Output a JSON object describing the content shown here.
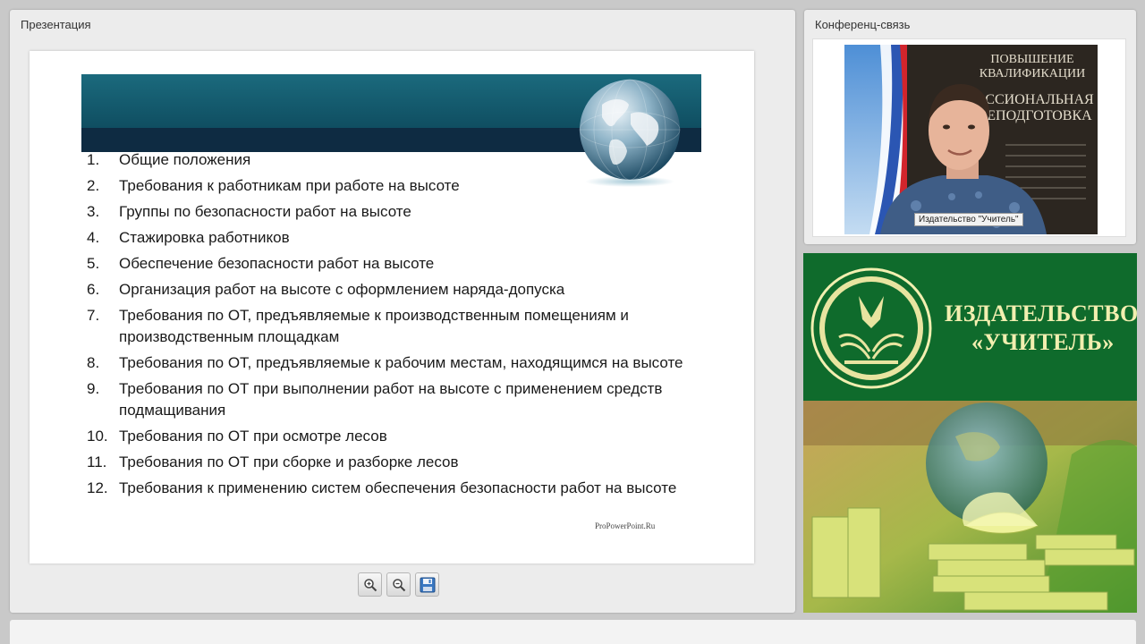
{
  "presentation_panel": {
    "title": "Презентация",
    "slide": {
      "items": [
        {
          "num": "1.",
          "text": "Общие положения"
        },
        {
          "num": "2.",
          "text": "Требования к работникам при работе на высоте"
        },
        {
          "num": "3.",
          "text": "Группы по безопасности работ на высоте"
        },
        {
          "num": "4.",
          "text": "Стажировка работников"
        },
        {
          "num": "5.",
          "text": "Обеспечение безопасности работ на высоте"
        },
        {
          "num": "6.",
          "text": "Организация работ на высоте с оформлением наряда-допуска"
        },
        {
          "num": "7.",
          "text": "Требования по ОТ, предъявляемые к производственным помещениям и производственным площадкам"
        },
        {
          "num": "8.",
          "text": "Требования по ОТ, предъявляемые к рабочим местам, находящимся на высоте"
        },
        {
          "num": "9.",
          "text": "Требования по ОТ при выполнении работ на высоте с применением средств подмащивания"
        },
        {
          "num": "10.",
          "text": "Требования по ОТ при осмотре лесов"
        },
        {
          "num": "11.",
          "text": "Требования по ОТ при сборке и разборке лесов"
        },
        {
          "num": "12.",
          "text": "Требования к применению систем обеспечения безопасности работ на высоте"
        }
      ],
      "watermark": "ProPowerPoint.Ru"
    },
    "toolbar": {
      "zoom_in_icon": "zoom-in-icon",
      "zoom_out_icon": "zoom-out-icon",
      "save_icon": "save-icon"
    }
  },
  "conference_panel": {
    "title": "Конференц-связь",
    "video_caption": "Издательство \"Учитель\"",
    "banner_text": [
      "ПОВЫШЕНИЕ",
      "КВАЛИФИКАЦИИ",
      "ССИОНАЛЬНАЯ",
      "ЕПОДГОТОВКА"
    ]
  },
  "publisher": {
    "line1": "ИЗДАТЕЛЬСТВО",
    "line2": "«УЧИТЕЛЬ»"
  },
  "colors": {
    "slide_header_teal": "#15607a",
    "slide_header_navy": "#0e2b42",
    "publisher_green": "#0f6b2c",
    "publisher_text": "#f2efb0"
  }
}
